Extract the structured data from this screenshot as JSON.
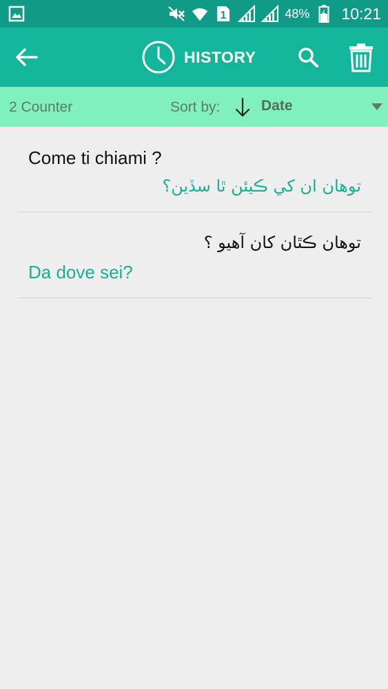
{
  "status_bar": {
    "battery_percent": "48%",
    "time": "10:21",
    "sim_label": "1",
    "icons": [
      "gallery-notification-icon",
      "mute-icon",
      "wifi-icon",
      "sim-icon",
      "signal-icon",
      "signal-icon",
      "battery-charging-icon"
    ]
  },
  "app_bar": {
    "title": "HISTORY",
    "icons": [
      "back-arrow-icon",
      "clock-icon",
      "search-icon",
      "trash-icon"
    ]
  },
  "sort_bar": {
    "counter": "2 Counter",
    "sort_label": "Sort by:",
    "sort_value": "Date",
    "icons": [
      "arrow-down-icon",
      "dropdown-triangle-icon"
    ]
  },
  "history": [
    {
      "source": "Come ti chiami ?",
      "translation": "توهان ان کي ڪيئن ٿا سڏين؟"
    },
    {
      "source": "توهان ڪٿان کان آهيو ؟",
      "translation": "Da dove sei?"
    }
  ],
  "colors": {
    "status_bar": "#0f9b86",
    "app_bar": "#14b69b",
    "sort_bar": "#7ff0be",
    "accent_text": "#17ae96",
    "background": "#eeeeee"
  }
}
